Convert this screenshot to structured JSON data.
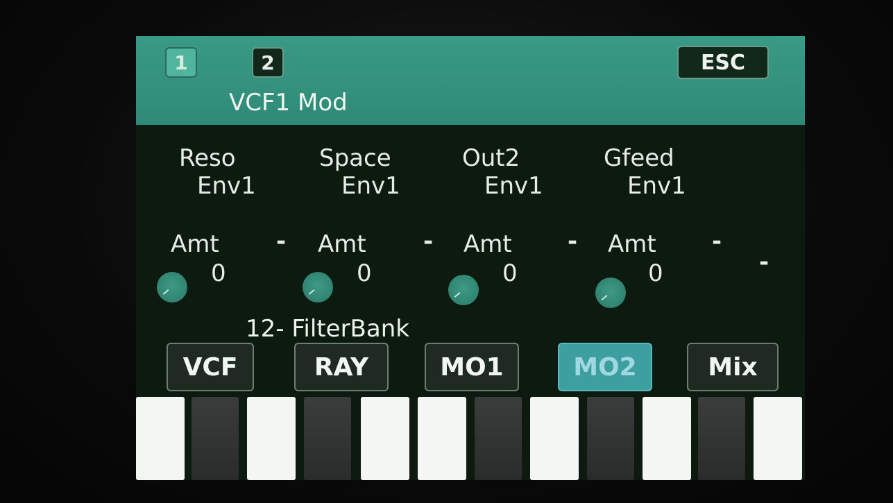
{
  "header": {
    "tabs": [
      {
        "label": "1",
        "active": true
      },
      {
        "label": "2",
        "active": false
      }
    ],
    "esc_label": "ESC",
    "title": "VCF1 Mod"
  },
  "params": [
    {
      "name": "Reso",
      "source": "Env1",
      "amt_label": "Amt",
      "amt_value": "0",
      "dash": "-"
    },
    {
      "name": "Space",
      "source": "Env1",
      "amt_label": "Amt",
      "amt_value": "0",
      "dash": "-"
    },
    {
      "name": "Out2",
      "source": "Env1",
      "amt_label": "Amt",
      "amt_value": "0",
      "dash": "-"
    },
    {
      "name": "Gfeed",
      "source": "Env1",
      "amt_label": "Amt",
      "amt_value": "0",
      "dash": "-"
    }
  ],
  "extra_dash": "-",
  "algorithm": "12- FilterBank",
  "page_buttons": [
    {
      "label": "VCF",
      "active": false
    },
    {
      "label": "RAY",
      "active": false
    },
    {
      "label": "MO1",
      "active": false
    },
    {
      "label": "MO2",
      "active": true
    },
    {
      "label": "Mix",
      "active": false
    }
  ],
  "colors": {
    "header_bg": "#2e8a77",
    "screen_bg": "#0c1a10",
    "active_button": "#3e9fa0",
    "knob": "#2a7a67"
  }
}
